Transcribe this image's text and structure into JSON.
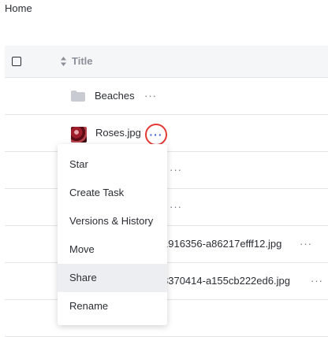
{
  "breadcrumb": "Home",
  "table": {
    "title_header": "Title",
    "rows": [
      {
        "name": "Beaches",
        "type": "folder",
        "more": "···"
      },
      {
        "name": "Roses.jpg",
        "type": "image",
        "more": "···"
      },
      {
        "name": "",
        "more": "···"
      },
      {
        "name": "",
        "more": "···"
      },
      {
        "name": "1916356-a86217efff12.jpg",
        "more": "···"
      },
      {
        "name": "8370414-a155cb222ed6.jpg",
        "more": "···"
      },
      {
        "name": "",
        "more": ""
      }
    ]
  },
  "context_menu": {
    "items": [
      "Star",
      "Create Task",
      "Versions & History",
      "Move",
      "Share",
      "Rename"
    ],
    "highlighted": "Share"
  },
  "colors": {
    "accent": "#3b5bdb",
    "highlight_ring": "#e53935",
    "menu_active_bg": "#eceef2"
  },
  "icons": [
    "folder-icon",
    "more-options-icon",
    "sort-icon",
    "checkbox-icon",
    "image-thumbnail"
  ]
}
